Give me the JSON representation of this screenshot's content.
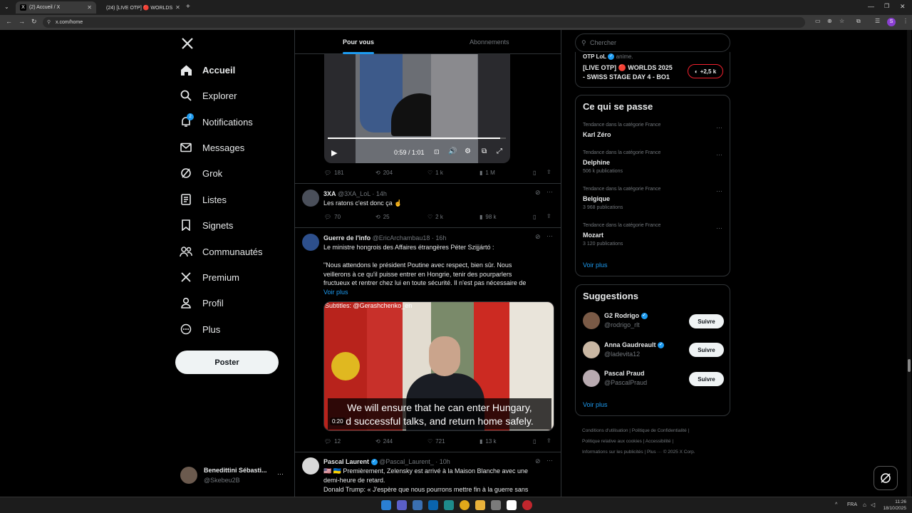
{
  "browser": {
    "tabs": [
      {
        "title": "(2) Accueil / X"
      },
      {
        "title": "(24) [LIVE OTP] 🔴 WORLDS"
      }
    ],
    "url": "x.com/home",
    "profile_initial": "S"
  },
  "nav": {
    "items": [
      {
        "label": "Accueil",
        "icon": "home-icon"
      },
      {
        "label": "Explorer",
        "icon": "search-icon"
      },
      {
        "label": "Notifications",
        "icon": "bell-icon",
        "badge": "2"
      },
      {
        "label": "Messages",
        "icon": "mail-icon"
      },
      {
        "label": "Grok",
        "icon": "grok-icon"
      },
      {
        "label": "Listes",
        "icon": "list-icon"
      },
      {
        "label": "Signets",
        "icon": "bookmark-icon"
      },
      {
        "label": "Communautés",
        "icon": "communities-icon"
      },
      {
        "label": "Premium",
        "icon": "x-logo-icon"
      },
      {
        "label": "Profil",
        "icon": "person-icon"
      },
      {
        "label": "Plus",
        "icon": "more-circle-icon"
      }
    ],
    "post_label": "Poster",
    "account": {
      "name": "Benedittini Sébasti...",
      "handle": "@Skebeu2B"
    }
  },
  "feed": {
    "tabs": [
      "Pour vous",
      "Abonnements"
    ],
    "video1": {
      "time": "0:59 / 1:01"
    },
    "tweet1_actions": {
      "replies": "181",
      "retweets": "204",
      "likes": "1 k",
      "views": "1 M"
    },
    "tweet2": {
      "name": "3XA",
      "handle": "@3XA_LoL",
      "time": "· 14h",
      "text": "Les ratons c'est donc ça ☝",
      "replies": "70",
      "retweets": "25",
      "likes": "2 k",
      "views": "98 k"
    },
    "tweet3": {
      "name": "Guerre de l'info",
      "handle": "@EricArchambau18",
      "time": "· 16h",
      "line1": "Le ministre hongrois des Affaires étrangères Péter Szijjártó :",
      "line2": "\"Nous attendons le président Poutine avec respect, bien sûr. Nous",
      "line3": "veillerons à ce qu'il puisse entrer en Hongrie, tenir des pourparlers",
      "line4": "fructueux et rentrer chez lui en toute sécurité. Il n'est pas nécessaire de",
      "more": "Voir plus",
      "video_caption_top": "Subtitles: @Gerashchenko_en",
      "subtitle1": "We will ensure that he can enter Hungary,",
      "subtitle2": "d successful talks, and return home safely.",
      "video_time": "0:20",
      "replies": "12",
      "retweets": "244",
      "likes": "721",
      "views": "13 k"
    },
    "tweet4": {
      "name": "Pascal Laurent",
      "handle": "@Pascal_Laurent_",
      "time": "· 10h",
      "line1": "🇺🇸 🇺🇦 Premièrement, Zelensky est arrivé à la Maison Blanche avec une",
      "line2": "demi-heure de retard.",
      "line3": "Donald Trump: « J'espère que nous pourrons mettre fin à la guerre sans"
    }
  },
  "right": {
    "search_placeholder": "Chercher",
    "live": {
      "account": "OTP LoL",
      "suffix": "anime.",
      "title1": "[LIVE OTP] 🔴 WORLDS 2025",
      "title2": "- SWISS STAGE DAY 4 - BO1",
      "count": "+2,5 k"
    },
    "trends": {
      "title": "Ce qui se passe",
      "items": [
        {
          "category": "Tendance dans la catégorie France",
          "name": "Karl Zéro",
          "count": ""
        },
        {
          "category": "Tendance dans la catégorie France",
          "name": "Delphine",
          "count": "506 k publications"
        },
        {
          "category": "Tendance dans la catégorie France",
          "name": "Belgique",
          "count": "3 968 publications"
        },
        {
          "category": "Tendance dans la catégorie France",
          "name": "Mozart",
          "count": "3 120 publications"
        }
      ],
      "more": "Voir plus"
    },
    "suggestions": {
      "title": "Suggestions",
      "items": [
        {
          "name": "G2 Rodrigo",
          "handle": "@rodrigo_rlt",
          "follow": "Suivre"
        },
        {
          "name": "Anna Gaudreault",
          "handle": "@ladevita12",
          "follow": "Suivre"
        },
        {
          "name": "Pascal Praud",
          "handle": "@PascalPraud",
          "follow": "Suivre"
        }
      ],
      "more": "Voir plus"
    },
    "footer": {
      "l1": "Conditions d'utilisation",
      "l2": "Politique de Confidentialité",
      "l3": "Politique relative aux cookies",
      "l4": "Accessibilité",
      "l5": "Informations sur les publicités",
      "l6": "Plus ···",
      "l7": "© 2025 X Corp."
    }
  },
  "taskbar": {
    "lang": "FRA",
    "time": "11:26",
    "date": "18/10/2025"
  }
}
